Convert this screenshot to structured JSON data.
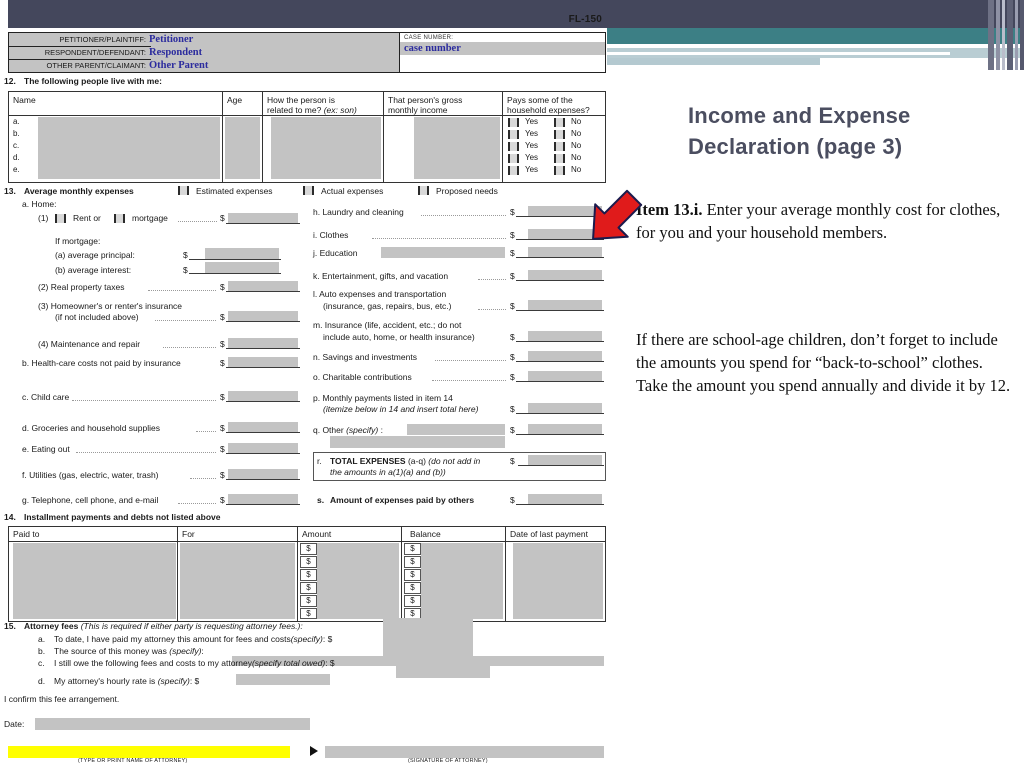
{
  "form": {
    "form_number": "FL-150",
    "caption": {
      "petitioner_label": "PETITIONER/PLAINTIFF:",
      "petitioner_value": "Petitioner",
      "respondent_label": "RESPONDENT/DEFENDANT:",
      "respondent_value": "Respondent",
      "other_parent_label": "OTHER PARENT/CLAIMANT:",
      "other_parent_value": "Other Parent",
      "case_number_label": "CASE NUMBER:",
      "case_number_value": "case number"
    },
    "item12": {
      "number": "12.",
      "title": "The following people live with me:",
      "columns": [
        "Name",
        "Age",
        "How the person is related to me? (ex: son)",
        "That person's gross monthly income",
        "Pays some of the household expenses?"
      ],
      "col_head_lines": {
        "name": "Name",
        "age": "Age",
        "rel_1": "How the person is",
        "rel_2": "related to me?",
        "rel_2_it": "(ex: son)",
        "inc_1": "That person's gross",
        "inc_2": "monthly income",
        "pay_1": "Pays some of the",
        "pay_2": "household expenses?"
      },
      "rows": [
        "a.",
        "b.",
        "c.",
        "d.",
        "e."
      ],
      "yes_label": "Yes",
      "no_label": "No"
    },
    "item13": {
      "number": "13.",
      "title": "Average monthly expenses",
      "checkboxes": [
        "Estimated expenses",
        "Actual expenses",
        "Proposed needs"
      ],
      "left": {
        "a_label": "a. Home:",
        "a1_pre": "(1)",
        "a1_rent": "Rent or",
        "a1_mortgage": "mortgage",
        "if_mortgage": "If mortgage:",
        "a_a": "(a)   average principal:",
        "a_b": "(b)   average interest:",
        "a2": "(2)  Real property taxes",
        "a3_line1": "(3)  Homeowner's or renter's insurance",
        "a3_line2": "(if not included above)",
        "a4": "(4)  Maintenance and repair",
        "b": "b.  Health-care costs not paid by insurance",
        "c": "c.  Child care",
        "d": "d.  Groceries and household supplies",
        "e": "e.  Eating out",
        "f": "f.  Utilities (gas, electric, water, trash)",
        "g": "g.  Telephone, cell phone, and e-mail"
      },
      "right": {
        "h": "h.  Laundry and cleaning",
        "i": "i.   Clothes",
        "j": "j.   Education",
        "k": "k.  Entertainment, gifts, and vacation",
        "l_line1": "l.   Auto expenses and transportation",
        "l_line2": "(insurance, gas, repairs, bus, etc.)",
        "m_line1": "m. Insurance (life, accident, etc.; do not",
        "m_line2": "include auto, home, or health insurance)",
        "n": "n.  Savings and investments",
        "o": "o.  Charitable contributions",
        "p_line1": "p.  Monthly payments listed in item 14",
        "p_line2": "(itemize below in 14 and insert total here)",
        "q": "q.  Other",
        "q_specify": "(specify)",
        "q_colon": ":",
        "r_letter": "r.",
        "r_bold": "TOTAL EXPENSES",
        "r_plain": "(a-q)",
        "r_italic1": "(do not add in",
        "r_italic2": "the amounts in a(1)(a) and (b))",
        "s_letter": "s.",
        "s_label": "Amount of expenses paid by others"
      },
      "dollar_sign": "$"
    },
    "item14": {
      "number": "14.",
      "title": "Installment payments and debts not listed above",
      "columns": [
        "Paid to",
        "For",
        "Amount",
        "Balance",
        "Date of last payment"
      ],
      "row_count": 6,
      "dollar_sign": "$"
    },
    "item15": {
      "number": "15.",
      "title": "Attorney fees",
      "title_italic": "(This is required if either party is requesting attorney fees.):",
      "a_letter": "a.",
      "a_text": "To date, I have paid my attorney this amount for fees and costs",
      "a_it": "(specify)",
      "a_tail": ": $",
      "b_letter": "b.",
      "b_text": "The source of this money was",
      "b_it": "(specify)",
      "b_tail": ":",
      "c_letter": "c.",
      "c_text": "I still owe the following fees and costs to my attorney",
      "c_it": "(specify total owed)",
      "c_tail": ": $",
      "d_letter": "d.",
      "d_text": "My attorney's hourly rate is",
      "d_it": "(specify)",
      "d_tail": ": $",
      "confirm": "I confirm this fee arrangement.",
      "date_label": "Date:",
      "type_name_caption": "(TYPE OR PRINT NAME OF ATTORNEY)",
      "signature_caption": "(SIGNATURE OF ATTORNEY)"
    }
  },
  "slide": {
    "title_line1": "Income and Expense",
    "title_line2": "Declaration (page 3)",
    "paragraph1_bold": "Item 13.i.",
    "paragraph1_rest": "  Enter your average monthly cost for clothes, for you and your household members.",
    "paragraph2": "If there are school-age children, don’t forget to include the amounts you spend for “back-to-school” clothes.  Take the amount you spend annually and divide it by 12.",
    "arrow": "red-arrow-pointing-to-clothes-field"
  },
  "colors": {
    "banner_dark": "#44475c",
    "banner_teal": "#3c7f85",
    "banner_pale": "#b9cdd3",
    "title_gray": "#4b4e60",
    "form_fill_gray": "#c3c3c3",
    "caption_blue": "#2c2c9e",
    "arrow_red": "#e01b1b",
    "highlight_yellow": "#ffff00"
  }
}
